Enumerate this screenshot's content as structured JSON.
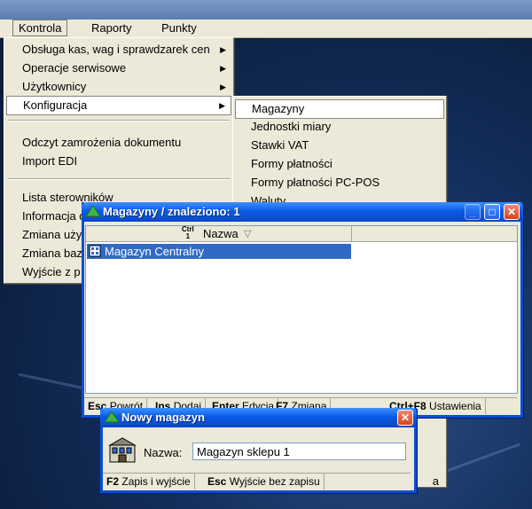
{
  "menubar": {
    "items": [
      {
        "label": "Kontrola"
      },
      {
        "label": "Raporty"
      },
      {
        "label": "Punkty"
      }
    ]
  },
  "kontrola_menu": {
    "items": [
      {
        "label": "Obsługa kas, wag i sprawdzarek cen"
      },
      {
        "label": "Operacje serwisowe"
      },
      {
        "label": "Użytkownicy"
      },
      {
        "label": "Konfiguracja"
      },
      {
        "label": "Odczyt zamrożenia dokumentu"
      },
      {
        "label": "Import EDI"
      },
      {
        "label": "Lista sterowników"
      },
      {
        "label": "Informacja o"
      },
      {
        "label": "Zmiana uży"
      },
      {
        "label": "Zmiana baz"
      },
      {
        "label": "Wyjście z p"
      }
    ]
  },
  "konfiguracja_menu": {
    "items": [
      {
        "label": "Magazyny"
      },
      {
        "label": "Jednostki miary"
      },
      {
        "label": "Stawki VAT"
      },
      {
        "label": "Formy płatności"
      },
      {
        "label": "Formy płatności PC-POS"
      },
      {
        "label": "Waluty"
      }
    ],
    "partial_label": "a"
  },
  "magazyny_window": {
    "title": "Magazyny / znaleziono: 1",
    "column": {
      "ctrl_hint_top": "Ctrl",
      "ctrl_hint_num": "1",
      "label": "Nazwa"
    },
    "rows": [
      {
        "name": "Magazyn Centralny"
      }
    ],
    "status": [
      {
        "key": "Esc",
        "label": "Powrót"
      },
      {
        "key": "Ins",
        "label": "Dodaj"
      },
      {
        "key": "Enter",
        "label": "Edycja"
      },
      {
        "key": "F7",
        "label": "Zmiana"
      },
      {
        "key": "Ctrl+F8",
        "label": "Ustawienia"
      }
    ]
  },
  "nowy_window": {
    "title": "Nowy magazyn",
    "field_label": "Nazwa:",
    "field_value": "Magazyn sklepu 1",
    "status": [
      {
        "key": "F2",
        "label": "Zapis i wyjście"
      },
      {
        "key": "Esc",
        "label": "Wyjście bez zapisu"
      }
    ]
  },
  "colors": {
    "title_blue": "#0a4fd6",
    "selection": "#316ac5",
    "chrome": "#ece9d8"
  }
}
